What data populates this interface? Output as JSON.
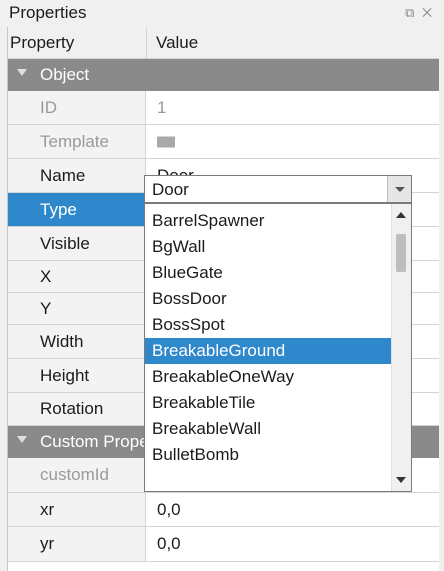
{
  "window": {
    "title": "Properties",
    "buttons": [
      "⧉",
      "✕"
    ]
  },
  "table": {
    "header": {
      "property": "Property",
      "value": "Value"
    },
    "groups": {
      "object": "Object",
      "custom": "Custom Properties"
    },
    "rows": {
      "id": {
        "name": "ID",
        "value": "1"
      },
      "template": {
        "name": "Template"
      },
      "name": {
        "name": "Name",
        "value": "Door"
      },
      "type": {
        "name": "Type",
        "value": "Door"
      },
      "visible": {
        "name": "Visible"
      },
      "x": {
        "name": "X"
      },
      "y": {
        "name": "Y"
      },
      "width": {
        "name": "Width"
      },
      "height": {
        "name": "Height"
      },
      "rotation": {
        "name": "Rotation"
      },
      "customId": {
        "name": "customId"
      },
      "xr": {
        "name": "xr",
        "value": "0,0"
      },
      "yr": {
        "name": "yr",
        "value": "0,0"
      }
    }
  },
  "dropdown": {
    "selected": "BreakableGround",
    "options": [
      "BarrelSpawner",
      "BgWall",
      "BlueGate",
      "BossDoor",
      "BossSpot",
      "BreakableGround",
      "BreakableOneWay",
      "BreakableTile",
      "BreakableWall",
      "BulletBomb"
    ]
  },
  "colors": {
    "selection": "#3088cc",
    "group": "#8a8a8a"
  }
}
